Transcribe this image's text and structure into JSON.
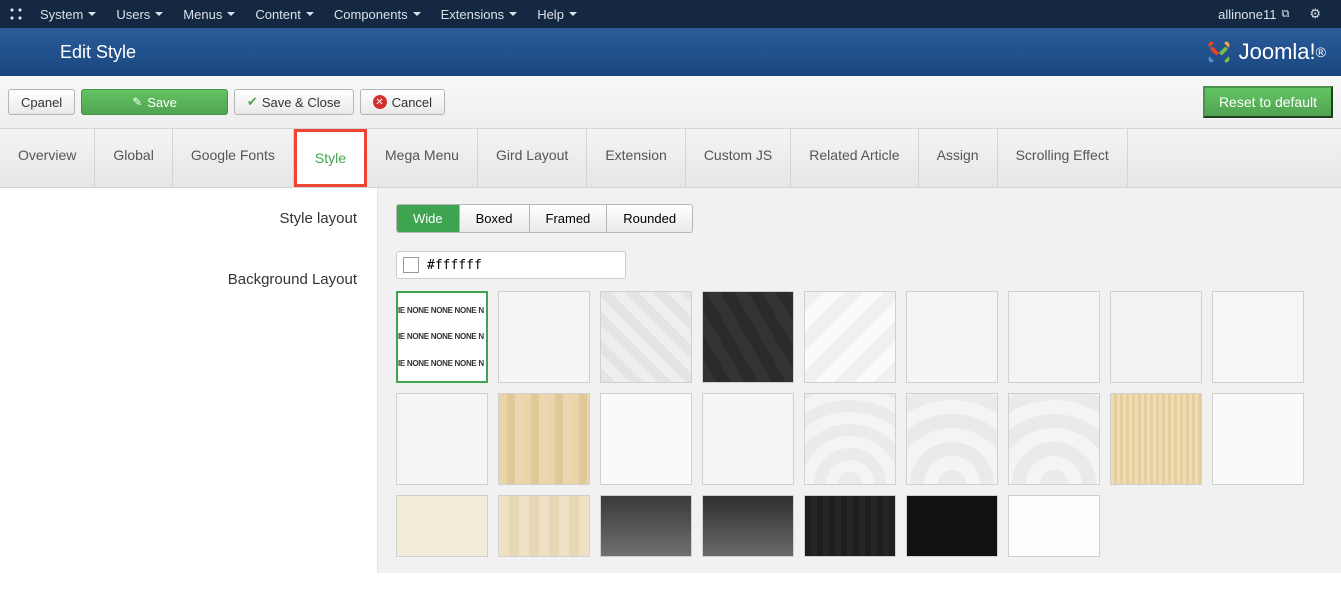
{
  "adminMenu": {
    "items": [
      "System",
      "Users",
      "Menus",
      "Content",
      "Components",
      "Extensions",
      "Help"
    ],
    "username": "allinone11"
  },
  "header": {
    "title": "Edit Style",
    "brand": "Joomla!"
  },
  "toolbar": {
    "cpanel": "Cpanel",
    "save": "Save",
    "saveClose": "Save & Close",
    "cancel": "Cancel",
    "reset": "Reset to default"
  },
  "tabs": [
    "Overview",
    "Global",
    "Google Fonts",
    "Style",
    "Mega Menu",
    "Gird Layout",
    "Extension",
    "Custom JS",
    "Related Article",
    "Assign",
    "Scrolling Effect"
  ],
  "activeTab": "Style",
  "styleLayout": {
    "label": "Style layout",
    "options": [
      "Wide",
      "Boxed",
      "Framed",
      "Rounded"
    ],
    "active": "Wide"
  },
  "backgroundLayout": {
    "label": "Background Layout",
    "colorValue": "#ffffff",
    "noneText": "IE NONE NONE NONE N"
  }
}
